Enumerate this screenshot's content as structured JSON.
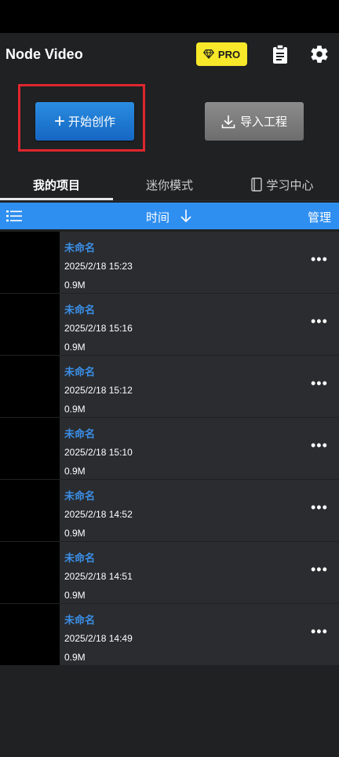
{
  "app": {
    "title": "Node Video"
  },
  "pro_badge": {
    "label": "PRO"
  },
  "actions": {
    "create_label": "开始创作",
    "import_label": "导入工程"
  },
  "tabs": [
    {
      "label": "我的项目",
      "active": true
    },
    {
      "label": "迷你模式",
      "active": false
    },
    {
      "label": "学习中心",
      "active": false
    }
  ],
  "sortbar": {
    "sort_label": "时间",
    "sort_direction": "descending",
    "manage_label": "管理"
  },
  "projects": [
    {
      "name": "未命名",
      "date": "2025/2/18 15:23",
      "size": "0.9M",
      "more": "•••"
    },
    {
      "name": "未命名",
      "date": "2025/2/18 15:16",
      "size": "0.9M",
      "more": "•••"
    },
    {
      "name": "未命名",
      "date": "2025/2/18 15:12",
      "size": "0.9M",
      "more": "•••"
    },
    {
      "name": "未命名",
      "date": "2025/2/18 15:10",
      "size": "0.9M",
      "more": "•••"
    },
    {
      "name": "未命名",
      "date": "2025/2/18 14:52",
      "size": "0.9M",
      "more": "•••"
    },
    {
      "name": "未命名",
      "date": "2025/2/18 14:51",
      "size": "0.9M",
      "more": "•••"
    },
    {
      "name": "未命名",
      "date": "2025/2/18 14:49",
      "size": "0.9M",
      "more": "•••"
    }
  ],
  "colors": {
    "accent_blue": "#2f8ff0",
    "highlight_red": "#e0262e",
    "pro_yellow": "#f7e82a",
    "project_name": "#3b8fe8"
  }
}
